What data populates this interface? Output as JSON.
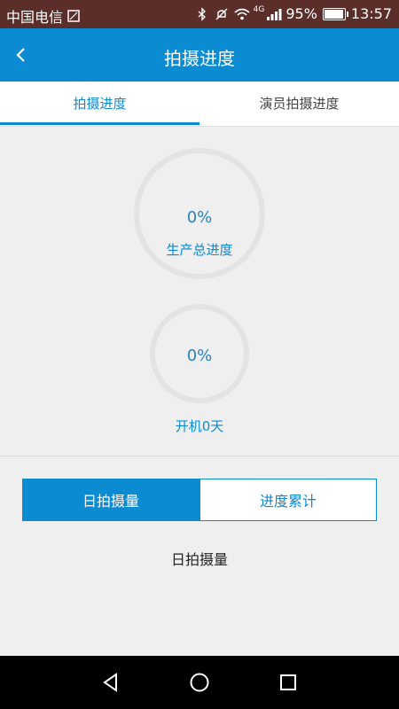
{
  "status_bar": {
    "carrier": "中国电信",
    "network": "4G",
    "battery_percent": "95%",
    "battery_level": 0.95,
    "time": "13:57"
  },
  "app_bar": {
    "title": "拍摄进度",
    "back_icon": "chevron-left-icon"
  },
  "tabs": [
    {
      "label": "拍摄进度",
      "active": true
    },
    {
      "label": "演员拍摄进度",
      "active": false
    }
  ],
  "progress": {
    "production_percent": "0%",
    "production_label": "生产总进度",
    "shooting_percent": "0%",
    "shooting_label": "开机0天"
  },
  "segmented": [
    {
      "label": "日拍摄量",
      "active": true
    },
    {
      "label": "进度累计",
      "active": false
    }
  ],
  "section": {
    "title": "日拍摄量"
  },
  "nav": {
    "back": "triangle-back-icon",
    "home": "circle-home-icon",
    "recent": "square-recent-icon"
  },
  "colors": {
    "accent": "#0b8bd2",
    "status_bar": "#5b2e2a"
  }
}
